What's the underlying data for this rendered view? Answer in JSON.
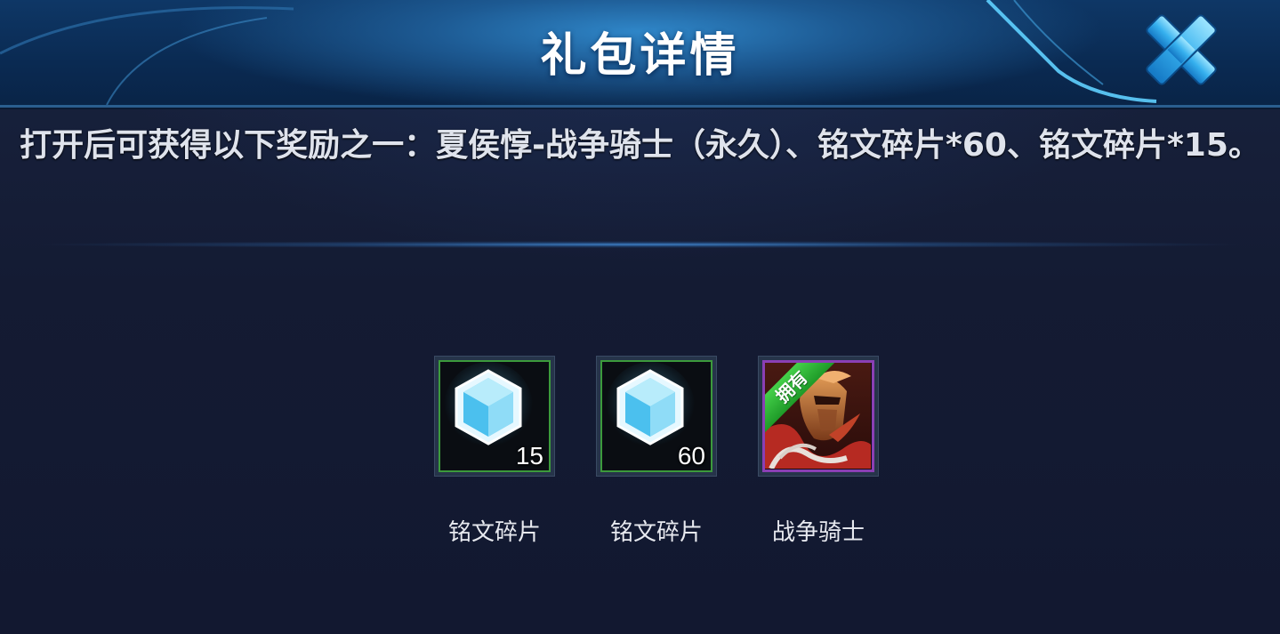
{
  "dialog": {
    "title": "礼包详情",
    "description": "打开后可获得以下奖励之一：夏侯惇-战争骑士（永久）、铭文碎片*60、铭文碎片*15。"
  },
  "rewards": [
    {
      "name": "铭文碎片",
      "count": "15",
      "icon": "crystal-icon"
    },
    {
      "name": "铭文碎片",
      "count": "60",
      "icon": "crystal-icon"
    },
    {
      "name": "战争骑士",
      "badge": "拥有",
      "icon": "hero-skin-portrait"
    }
  ],
  "colors": {
    "header_blue": "#1d5a93",
    "background": "#131a30",
    "rarity_green": "#3c9a3c",
    "rarity_purple": "#8a3fb4",
    "owned_badge": "#2fb836"
  }
}
